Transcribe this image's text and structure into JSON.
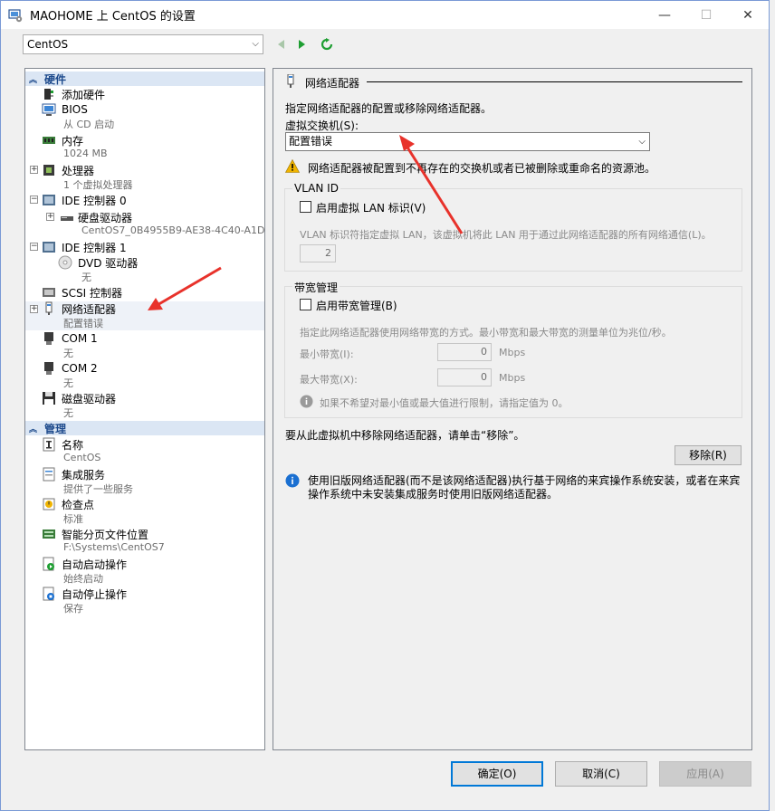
{
  "window": {
    "title": "MAOHOME 上 CentOS 的设置",
    "minimize": "—",
    "maximize": "☐",
    "close": "✕"
  },
  "toolbar": {
    "vm_selected": "CentOS"
  },
  "tree": {
    "hardware_header": "硬件",
    "management_header": "管理",
    "hardware": [
      {
        "label": "添加硬件",
        "sub": ""
      },
      {
        "label": "BIOS",
        "sub": "从 CD 启动"
      },
      {
        "label": "内存",
        "sub": "1024 MB"
      },
      {
        "label": "处理器",
        "sub": "1 个虚拟处理器"
      },
      {
        "label": "IDE 控制器 0",
        "sub": ""
      },
      {
        "label": "硬盘驱动器",
        "sub": "CentOS7_0B4955B9-AE38-4C40-A1D3..."
      },
      {
        "label": "IDE 控制器 1",
        "sub": ""
      },
      {
        "label": "DVD 驱动器",
        "sub": "无"
      },
      {
        "label": "SCSI 控制器",
        "sub": ""
      },
      {
        "label": "网络适配器",
        "sub": "配置错误"
      },
      {
        "label": "COM 1",
        "sub": "无"
      },
      {
        "label": "COM 2",
        "sub": "无"
      },
      {
        "label": "磁盘驱动器",
        "sub": "无"
      }
    ],
    "management": [
      {
        "label": "名称",
        "sub": "CentOS"
      },
      {
        "label": "集成服务",
        "sub": "提供了一些服务"
      },
      {
        "label": "检查点",
        "sub": "标准"
      },
      {
        "label": "智能分页文件位置",
        "sub": "F:\\Systems\\CentOS7"
      },
      {
        "label": "自动启动操作",
        "sub": "始终启动"
      },
      {
        "label": "自动停止操作",
        "sub": "保存"
      }
    ]
  },
  "panel": {
    "title": "网络适配器",
    "description": "指定网络适配器的配置或移除网络适配器。",
    "switch_label": "虚拟交换机(S):",
    "switch_value": "配置错误",
    "warning": "网络适配器被配置到不再存在的交换机或者已被删除或重命名的资源池。",
    "vlan": {
      "title": "VLAN ID",
      "enable_label": "启用虚拟 LAN 标识(V)",
      "description": "VLAN 标识符指定虚拟 LAN，该虚拟机将此 LAN 用于通过此网络适配器的所有网络通信(L)。",
      "value": "2"
    },
    "bandwidth": {
      "title": "带宽管理",
      "enable_label": "启用带宽管理(B)",
      "description": "指定此网络适配器使用网络带宽的方式。最小带宽和最大带宽的测量单位为兆位/秒。",
      "min_label": "最小带宽(I):",
      "min_value": "0",
      "max_label": "最大带宽(X):",
      "max_value": "0",
      "unit": "Mbps",
      "info": "如果不希望对最小值或最大值进行限制，请指定值为 0。"
    },
    "remove_text": "要从此虚拟机中移除网络适配器，请单击“移除”。",
    "remove_button": "移除(R)",
    "legacy_info": "使用旧版网络适配器(而不是该网络适配器)执行基于网络的来宾操作系统安装，或者在来宾操作系统中未安装集成服务时使用旧版网络适配器。"
  },
  "buttons": {
    "ok": "确定(O)",
    "cancel": "取消(C)",
    "apply": "应用(A)"
  },
  "colors": {
    "accent": "#0078d7",
    "header_bg": "#dbe6f4",
    "header_text": "#1d4a8c",
    "warning": "#f0b400",
    "info": "#1a6fd1",
    "annotation": "#e8322b"
  }
}
